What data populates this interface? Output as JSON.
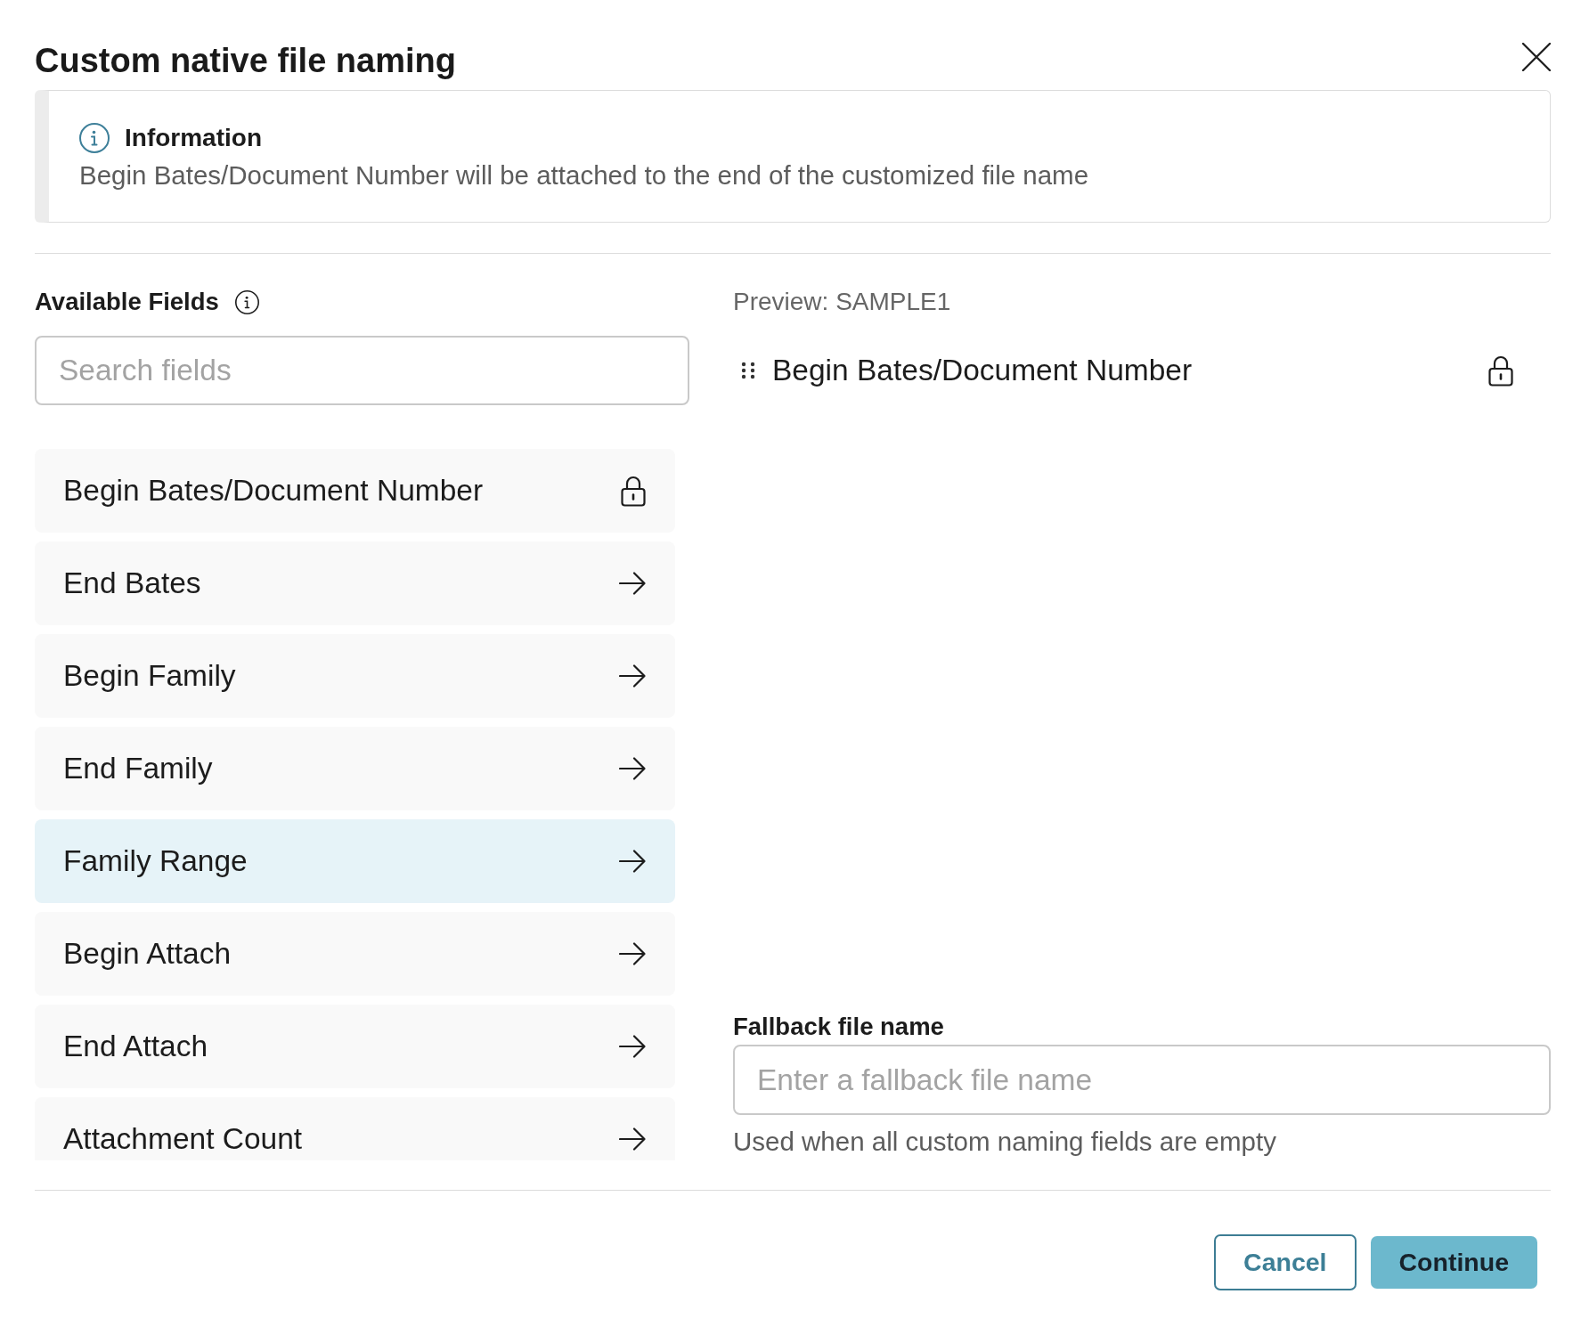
{
  "dialog": {
    "title": "Custom native file naming"
  },
  "info": {
    "title": "Information",
    "message": "Begin Bates/Document Number will be attached to the end of the customized file name"
  },
  "available_fields": {
    "label": "Available Fields",
    "search": {
      "placeholder": "Search fields"
    },
    "items": [
      {
        "label": "Begin Bates/Document Number",
        "kind": "locked",
        "selected": false
      },
      {
        "label": "End Bates",
        "kind": "addable",
        "selected": false
      },
      {
        "label": "Begin Family",
        "kind": "addable",
        "selected": false
      },
      {
        "label": "End Family",
        "kind": "addable",
        "selected": false
      },
      {
        "label": "Family Range",
        "kind": "addable",
        "selected": true
      },
      {
        "label": "Begin Attach",
        "kind": "addable",
        "selected": false
      },
      {
        "label": "End Attach",
        "kind": "addable",
        "selected": false
      },
      {
        "label": "Attachment Count",
        "kind": "addable",
        "selected": false
      }
    ]
  },
  "preview": {
    "label": "Preview: SAMPLE1",
    "items": [
      {
        "label": "Begin Bates/Document Number",
        "kind": "locked"
      }
    ]
  },
  "fallback": {
    "label": "Fallback file name",
    "placeholder": "Enter a fallback file name",
    "hint": "Used when all custom naming fields are empty"
  },
  "buttons": [
    {
      "label": "Cancel",
      "kind": "secondary"
    },
    {
      "label": "Continue",
      "kind": "primary"
    }
  ]
}
